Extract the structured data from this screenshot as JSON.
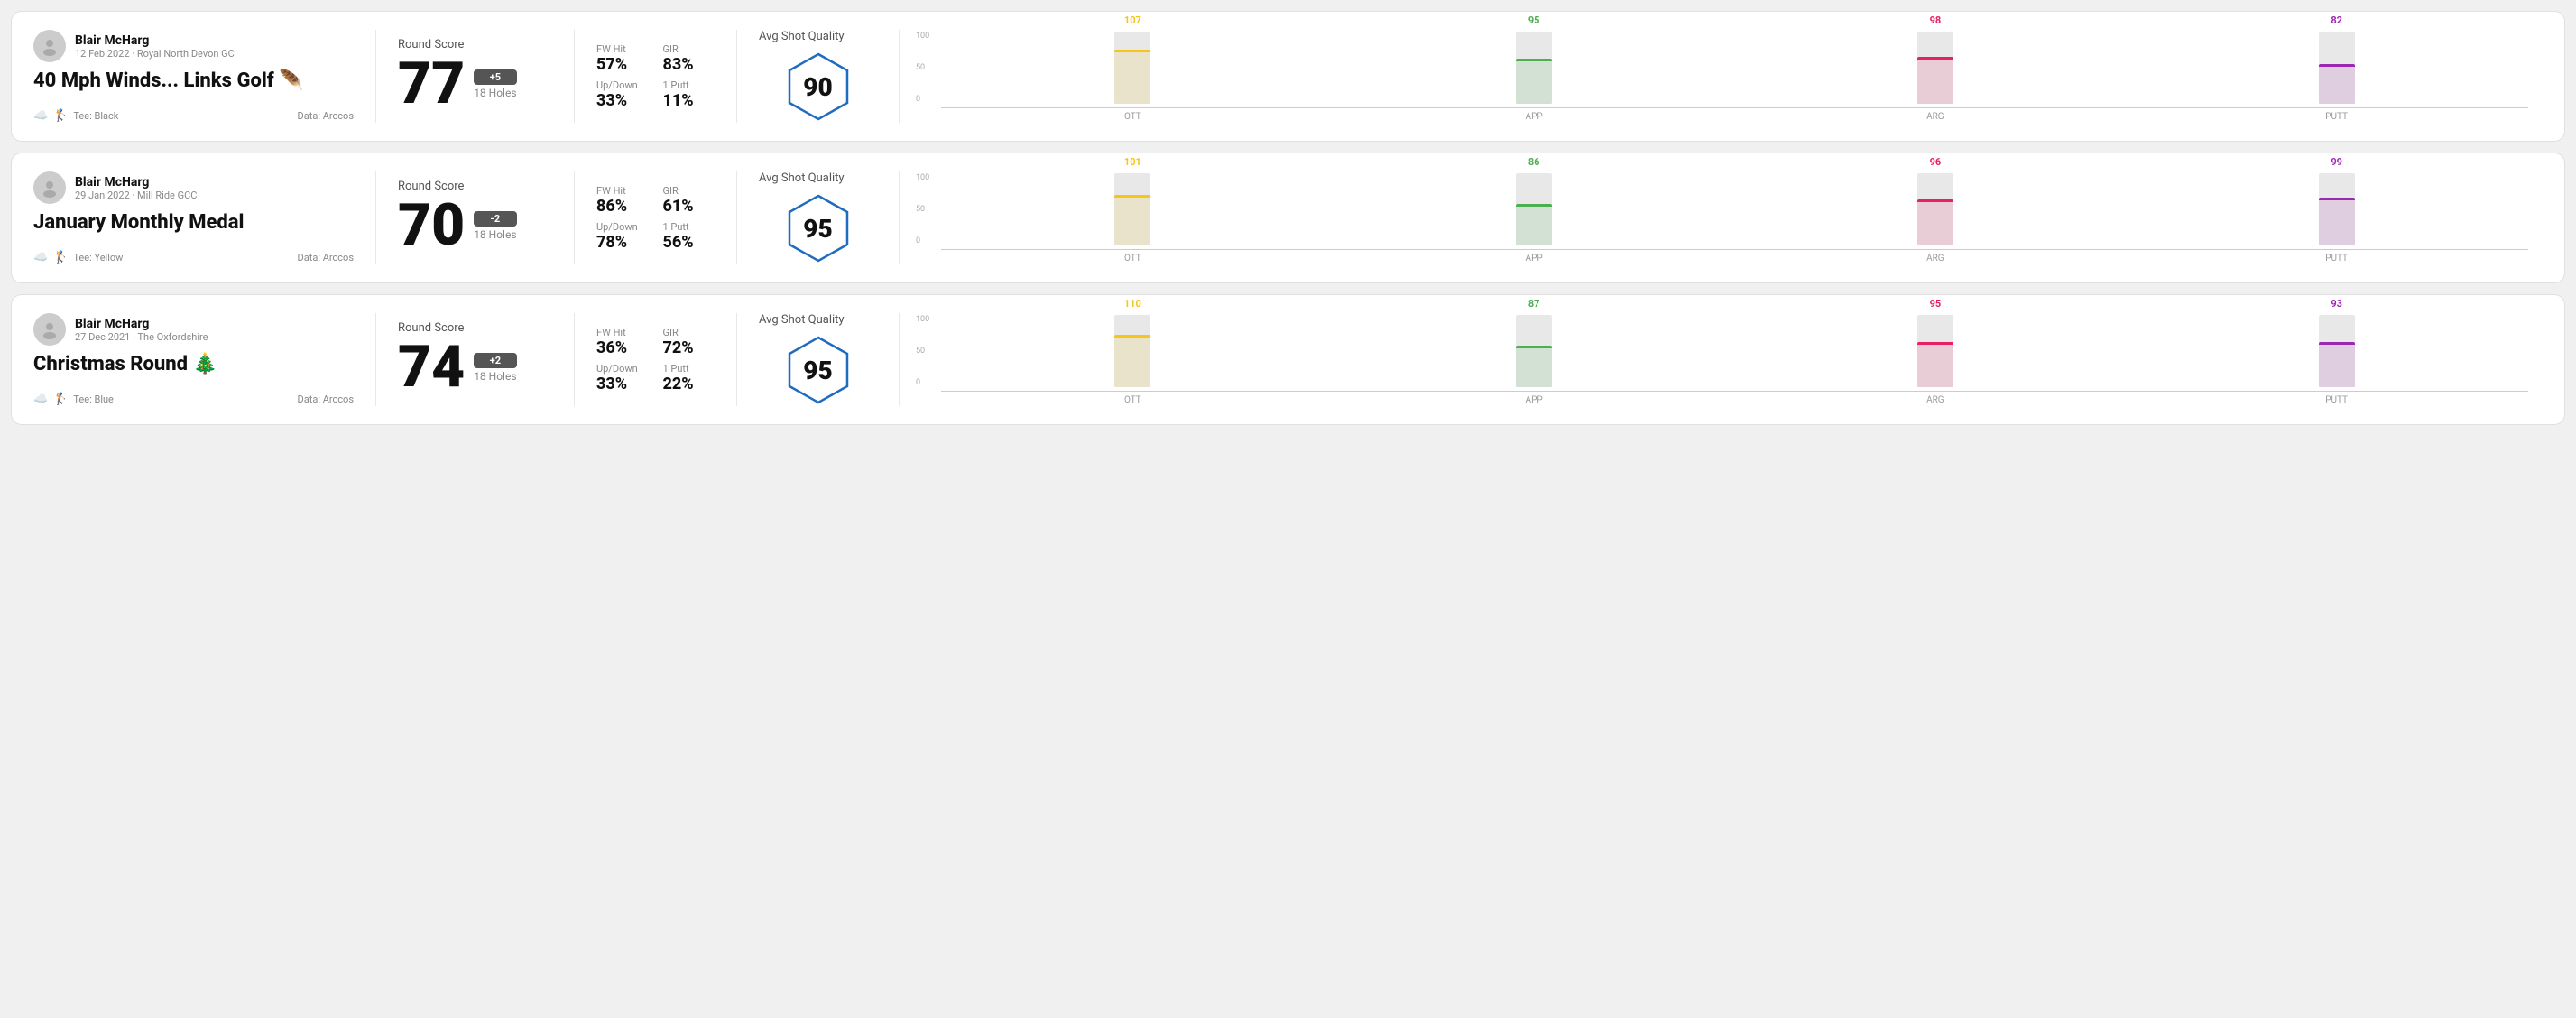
{
  "rounds": [
    {
      "id": "round1",
      "player": {
        "name": "Blair McHarg",
        "date": "12 Feb 2022",
        "course": "Royal North Devon GC"
      },
      "title": "40 Mph Winds... Links Golf 🪶",
      "tee": "Black",
      "data_source": "Arccos",
      "score": {
        "label": "Round Score",
        "value": "77",
        "badge": "+5",
        "holes": "18 Holes"
      },
      "stats": [
        {
          "name": "FW Hit",
          "value": "57%"
        },
        {
          "name": "GIR",
          "value": "83%"
        },
        {
          "name": "Up/Down",
          "value": "33%"
        },
        {
          "name": "1 Putt",
          "value": "11%"
        }
      ],
      "quality": {
        "label": "Avg Shot Quality",
        "score": "90"
      },
      "chart": {
        "bars": [
          {
            "label": "OTT",
            "value": 107,
            "color": "#f5c518",
            "pct": 75
          },
          {
            "label": "APP",
            "value": 95,
            "color": "#4caf50",
            "pct": 62
          },
          {
            "label": "ARG",
            "value": 98,
            "color": "#e91e63",
            "pct": 65
          },
          {
            "label": "PUTT",
            "value": 82,
            "color": "#9c27b0",
            "pct": 55
          }
        ]
      }
    },
    {
      "id": "round2",
      "player": {
        "name": "Blair McHarg",
        "date": "29 Jan 2022",
        "course": "Mill Ride GCC"
      },
      "title": "January Monthly Medal",
      "tee": "Yellow",
      "data_source": "Arccos",
      "score": {
        "label": "Round Score",
        "value": "70",
        "badge": "-2",
        "holes": "18 Holes"
      },
      "stats": [
        {
          "name": "FW Hit",
          "value": "86%"
        },
        {
          "name": "GIR",
          "value": "61%"
        },
        {
          "name": "Up/Down",
          "value": "78%"
        },
        {
          "name": "1 Putt",
          "value": "56%"
        }
      ],
      "quality": {
        "label": "Avg Shot Quality",
        "score": "95"
      },
      "chart": {
        "bars": [
          {
            "label": "OTT",
            "value": 101,
            "color": "#f5c518",
            "pct": 70
          },
          {
            "label": "APP",
            "value": 86,
            "color": "#4caf50",
            "pct": 57
          },
          {
            "label": "ARG",
            "value": 96,
            "color": "#e91e63",
            "pct": 64
          },
          {
            "label": "PUTT",
            "value": 99,
            "color": "#9c27b0",
            "pct": 66
          }
        ]
      }
    },
    {
      "id": "round3",
      "player": {
        "name": "Blair McHarg",
        "date": "27 Dec 2021",
        "course": "The Oxfordshire"
      },
      "title": "Christmas Round 🎄",
      "tee": "Blue",
      "data_source": "Arccos",
      "score": {
        "label": "Round Score",
        "value": "74",
        "badge": "+2",
        "holes": "18 Holes"
      },
      "stats": [
        {
          "name": "FW Hit",
          "value": "36%"
        },
        {
          "name": "GIR",
          "value": "72%"
        },
        {
          "name": "Up/Down",
          "value": "33%"
        },
        {
          "name": "1 Putt",
          "value": "22%"
        }
      ],
      "quality": {
        "label": "Avg Shot Quality",
        "score": "95"
      },
      "chart": {
        "bars": [
          {
            "label": "OTT",
            "value": 110,
            "color": "#f5c518",
            "pct": 73
          },
          {
            "label": "APP",
            "value": 87,
            "color": "#4caf50",
            "pct": 58
          },
          {
            "label": "ARG",
            "value": 95,
            "color": "#e91e63",
            "pct": 63
          },
          {
            "label": "PUTT",
            "value": 93,
            "color": "#9c27b0",
            "pct": 62
          }
        ]
      }
    }
  ],
  "labels": {
    "y_axis": [
      "100",
      "50",
      "0"
    ],
    "data_source_prefix": "Data: "
  }
}
